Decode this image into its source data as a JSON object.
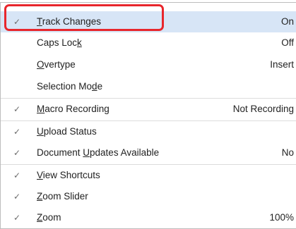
{
  "menu": {
    "items": [
      {
        "checked": true,
        "pre": "",
        "key": "T",
        "post": "rack Changes",
        "value": "On"
      },
      {
        "checked": false,
        "pre": "Caps Loc",
        "key": "k",
        "post": "",
        "value": "Off"
      },
      {
        "checked": false,
        "pre": "",
        "key": "O",
        "post": "vertype",
        "value": "Insert"
      },
      {
        "checked": false,
        "pre": "Selection Mo",
        "key": "d",
        "post": "e",
        "value": ""
      },
      {
        "checked": true,
        "pre": "",
        "key": "M",
        "post": "acro Recording",
        "value": "Not Recording"
      },
      {
        "checked": true,
        "pre": "",
        "key": "U",
        "post": "pload Status",
        "value": ""
      },
      {
        "checked": true,
        "pre": "Document ",
        "key": "U",
        "post": "pdates Available",
        "value": "No"
      },
      {
        "checked": true,
        "pre": "",
        "key": "V",
        "post": "iew Shortcuts",
        "value": ""
      },
      {
        "checked": true,
        "pre": "",
        "key": "Z",
        "post": "oom Slider",
        "value": ""
      },
      {
        "checked": true,
        "pre": "",
        "key": "Z",
        "post": "oom",
        "value": "100%"
      }
    ],
    "check_glyph": "✓",
    "highlight_color": "#d7e5f6",
    "callout_color": "#e8262c"
  }
}
